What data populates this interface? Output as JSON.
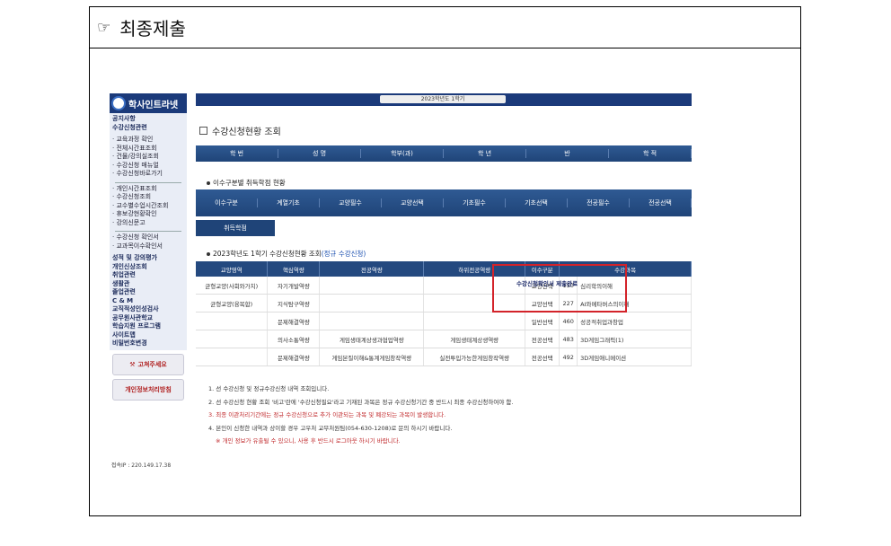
{
  "frame": {
    "title": "최종제출"
  },
  "sidebar": {
    "logo": "학사인트라넷",
    "items_top": [
      "공지사항",
      "수강신청관련"
    ],
    "group1": [
      "· 교육과정 확인",
      "· 전체시간표조회",
      "· 건물/강의실조회",
      "· 수강신청 매뉴얼",
      "· 수강신청바로가기"
    ],
    "group2": [
      "· 개인시간표조회",
      "· 수강신청조회",
      "· 교수별수업시간조회",
      "· 휴보강현황확인",
      "· 강의신문고"
    ],
    "group3": [
      "· 수강신청 확인서",
      "· 교과목이수확인서"
    ],
    "group4": [
      "성적 및 강의평가",
      "개인신상조회",
      "취업관련",
      "생활관",
      "졸업관련",
      "C & M",
      "교직적성인성검사",
      "공무원사관학교",
      "학습지원 프로그램",
      "사이트맵",
      "비밀번호변경"
    ],
    "btn_help": "고쳐주세요",
    "btn_privacy": "개인정보처리방침",
    "ip": "접속IP : 220.149.17.38"
  },
  "main": {
    "top_select": "2023학년도 1학기",
    "title": "수강신청현황 조회",
    "student_headers": [
      "학 번",
      "성 명",
      "학부(과)",
      "학 년",
      "반",
      "학 적"
    ],
    "credits_caption": "이수구분별 취득학점 현황",
    "credit_headers": [
      "이수구분",
      "계열기초",
      "교양필수",
      "교양선택",
      "기초필수",
      "기초선택",
      "전공필수",
      "전공선택"
    ],
    "credit_row_label": "취득학점",
    "courses_caption": "2023학년도 1학기 수강신청현황 조회",
    "courses_caption_tag": "(정규 수강신청)",
    "course_headers": [
      "교양영역",
      "핵심역량",
      "전공역량",
      "하위전공역량",
      "이수구분",
      "수강과목"
    ],
    "course_rows": [
      [
        "균형교양(사회와가치)",
        "자기개발역량",
        "",
        "",
        "교양선택",
        "150",
        "심리학의이해"
      ],
      [
        "균형교양(융복합)",
        "지식탐구역량",
        "",
        "",
        "교양선택",
        "227",
        "AI와메타버스의이해"
      ],
      [
        "",
        "문제해결역량",
        "",
        "",
        "일반선택",
        "460",
        "성공적취업과창업"
      ],
      [
        "",
        "의사소통역량",
        "게임생태계상생과협업역량",
        "게임생태계상생역량",
        "전공선택",
        "483",
        "3D게임그래픽(1)"
      ],
      [
        "",
        "문제해결역량",
        "게임본질이해&통계게임창작역량",
        "실전투입가능한게임창작역량",
        "전공선택",
        "492",
        "3D게임애니메이션"
      ]
    ],
    "popup": "수강신청확인서 제출완료",
    "notes": [
      "1. 선 수강신청 및 정규수강신청 내역 조회입니다.",
      "2. 선 수강신청 현황 조회 '비고'란에 '수강신청필요'라고 기재된 과목은 정규 수강신청기간 중 반드시 최종 수강신청하여야 함.",
      "3. 최종 이관처리기간에는 정규 수강신청으로 추가 이관되는 과목 및 폐강되는 과목이 발생합니다.",
      "4. 본인이 신청한 내역과 상이할 경우 고우처 교무처원팀(054-630-1208)로 문의 하시기 바랍니다.",
      "※ 개인 정보가 유출될 수 있으니, 사용 후 반드시 로그아웃 하시기 바랍니다."
    ]
  }
}
